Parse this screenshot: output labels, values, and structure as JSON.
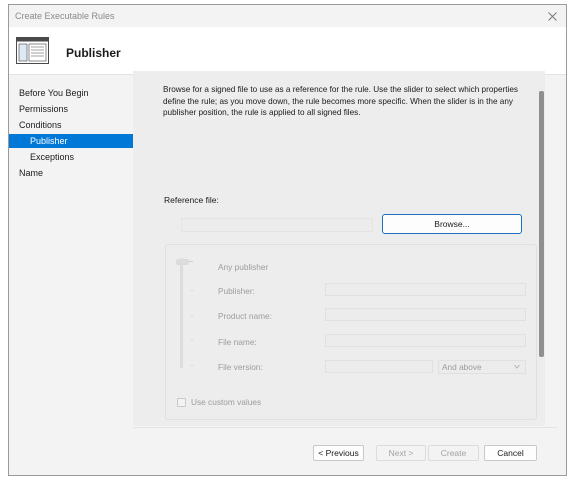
{
  "window": {
    "title": "Create Executable Rules",
    "close_icon": "close-icon"
  },
  "banner": {
    "icon": "rule-window-icon",
    "title": "Publisher"
  },
  "sidebar": {
    "items": [
      {
        "label": "Before You Begin",
        "level": 0,
        "selected": false
      },
      {
        "label": "Permissions",
        "level": 0,
        "selected": false
      },
      {
        "label": "Conditions",
        "level": 0,
        "selected": false
      },
      {
        "label": "Publisher",
        "level": 1,
        "selected": true
      },
      {
        "label": "Exceptions",
        "level": 1,
        "selected": false
      },
      {
        "label": "Name",
        "level": 0,
        "selected": false
      }
    ]
  },
  "main": {
    "description": "Browse for a signed file to use as a reference for the rule. Use the slider to select which properties define the rule; as you move down, the rule becomes more specific. When the slider is in the any publisher position, the rule is applied to all signed files.",
    "reference_file_label": "Reference file:",
    "reference_file_value": "",
    "browse_label": "Browse...",
    "slider": {
      "top_label": "Any publisher",
      "fields": [
        {
          "label": "Publisher:",
          "value": ""
        },
        {
          "label": "Product name:",
          "value": ""
        },
        {
          "label": "File name:",
          "value": ""
        },
        {
          "label": "File version:",
          "value": ""
        }
      ],
      "version_option": "And above"
    },
    "custom_values_label": "Use custom values",
    "custom_values_checked": false
  },
  "footer": {
    "previous_label": "< Previous",
    "next_label": "Next >",
    "create_label": "Create",
    "cancel_label": "Cancel"
  },
  "colors": {
    "accent": "#0078d7",
    "window_bg": "#f3f3f3",
    "content_bg": "#ededed",
    "disabled_text": "#9c9c9c"
  }
}
